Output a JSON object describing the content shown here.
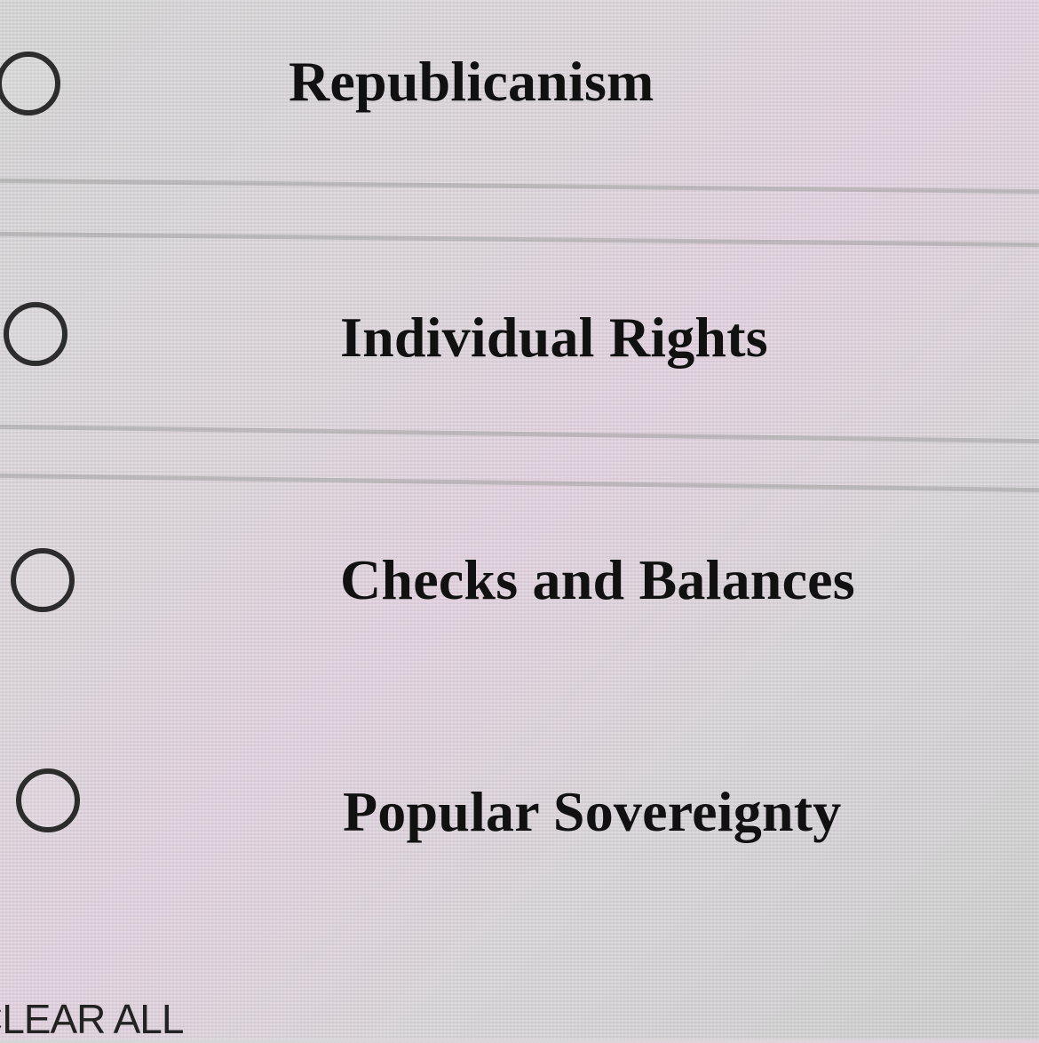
{
  "options": [
    {
      "label": "Republicanism",
      "selected": false
    },
    {
      "label": "Individual Rights",
      "selected": false
    },
    {
      "label": "Checks and Balances",
      "selected": false
    },
    {
      "label": "Popular Sovereignty",
      "selected": false
    }
  ],
  "clear_all": "CLEAR ALL"
}
